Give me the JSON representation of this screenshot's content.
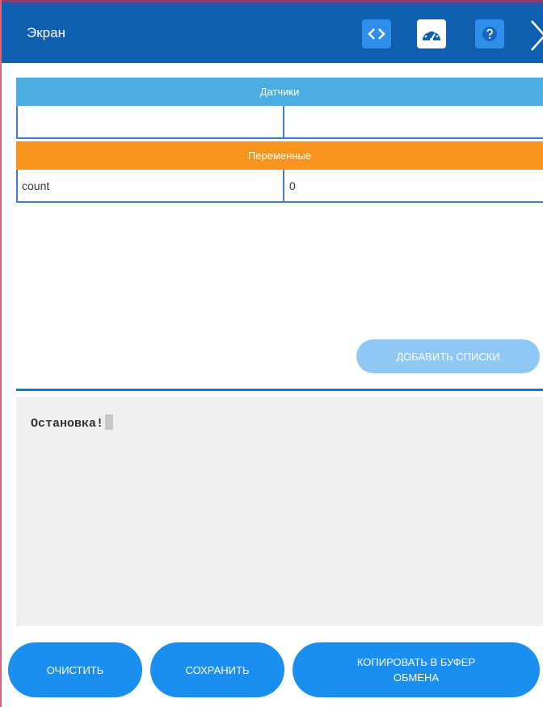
{
  "header": {
    "title": "Экран",
    "bg_color": "#0f5fb0"
  },
  "sensors": {
    "heading": "Датчики",
    "heading_color": "#4aaee3",
    "row": [
      "",
      ""
    ]
  },
  "variables": {
    "heading": "Переменные",
    "heading_color": "#f7941d",
    "rows": [
      {
        "name": "count",
        "value": "0"
      }
    ]
  },
  "add_lists_button": "ДОБАВИТЬ СПИСКИ",
  "console": {
    "text": "Остановка!"
  },
  "actions": {
    "clear": "ОЧИСТИТЬ",
    "save": "СОХРАНИТЬ",
    "copy": "КОПИРОВАТЬ В БУФЕР ОБМЕНА"
  },
  "icons": {
    "code": "code-brackets-icon",
    "gauge": "dashboard-gauge-icon",
    "help": "help-icon",
    "close": "close-icon"
  }
}
